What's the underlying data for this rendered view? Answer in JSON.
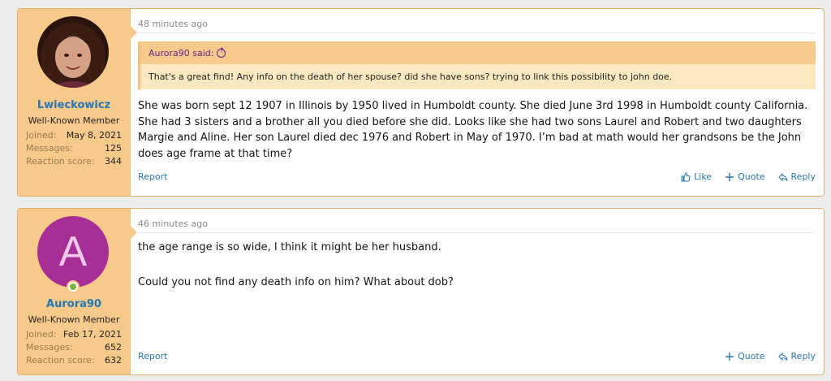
{
  "posts": [
    {
      "user": {
        "name": "Lwieckowicz",
        "title": "Well-Known Member",
        "stats": [
          {
            "key": "Joined:",
            "value": "May 8, 2021"
          },
          {
            "key": "Messages:",
            "value": "125"
          },
          {
            "key": "Reaction score:",
            "value": "344"
          }
        ]
      },
      "timestamp": "48 minutes ago",
      "quote": {
        "attribution": "Aurora90 said:",
        "text": "That's a great find! Any info on the death of her spouse? did she have sons? trying to link this possibility to john doe."
      },
      "body": "She was born sept 12 1907 in Illinois by 1950 lived in Humboldt county. She died June 3rd 1998 in Humboldt county California. She had 3 sisters and a brother all you died before she did. Looks like she had two sons Laurel and Robert and two daughters Margie and Aline. Her son Laurel died dec 1976 and Robert in May of 1970. I’m bad at math would her grandsons be the John does age frame at that time?",
      "footer": {
        "report": "Report",
        "like": "Like",
        "quote": "Quote",
        "reply": "Reply"
      }
    },
    {
      "user": {
        "avatar_letter": "A",
        "name": "Aurora90",
        "title": "Well-Known Member",
        "stats": [
          {
            "key": "Joined:",
            "value": "Feb 17, 2021"
          },
          {
            "key": "Messages:",
            "value": "652"
          },
          {
            "key": "Reaction score:",
            "value": "632"
          }
        ]
      },
      "timestamp": "46 minutes ago",
      "body_lines": [
        "the age range is so wide, I think it might be her husband.",
        "Could you not find any death info on him? What about dob?"
      ],
      "footer": {
        "report": "Report",
        "quote": "Quote",
        "reply": "Reply"
      }
    }
  ],
  "colors": {
    "accent": "#2577b1",
    "user_bg": "#f7c98b",
    "quote_bg": "#f9e8c0",
    "avatar_bg": "#a62e94",
    "online": "#7fb042"
  }
}
